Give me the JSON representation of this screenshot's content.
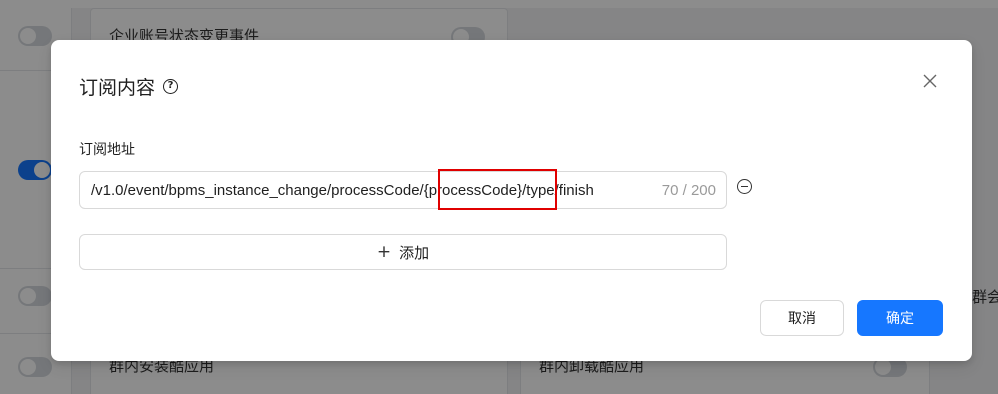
{
  "background": {
    "card_top_label": "企业账号状态变更事件",
    "card_bottom_left_label": "群内安装酷应用",
    "card_bottom_right_label": "群内卸载酷应用",
    "right_edge_text": "群会"
  },
  "modal": {
    "title": "订阅内容",
    "help_icon": "question-circle-icon",
    "close_icon": "close-icon",
    "field_label": "订阅地址",
    "input_value": "/v1.0/event/bpms_instance_change/processCode/{processCode}/type/finish",
    "char_count": "70 / 200",
    "remove_icon": "minus-circle-icon",
    "add_label": "添加",
    "add_icon": "plus-icon",
    "cancel_label": "取消",
    "ok_label": "确定"
  },
  "colors": {
    "primary": "#1677ff",
    "highlight": "#e00000",
    "mask": "rgba(0,0,0,0.45)"
  }
}
